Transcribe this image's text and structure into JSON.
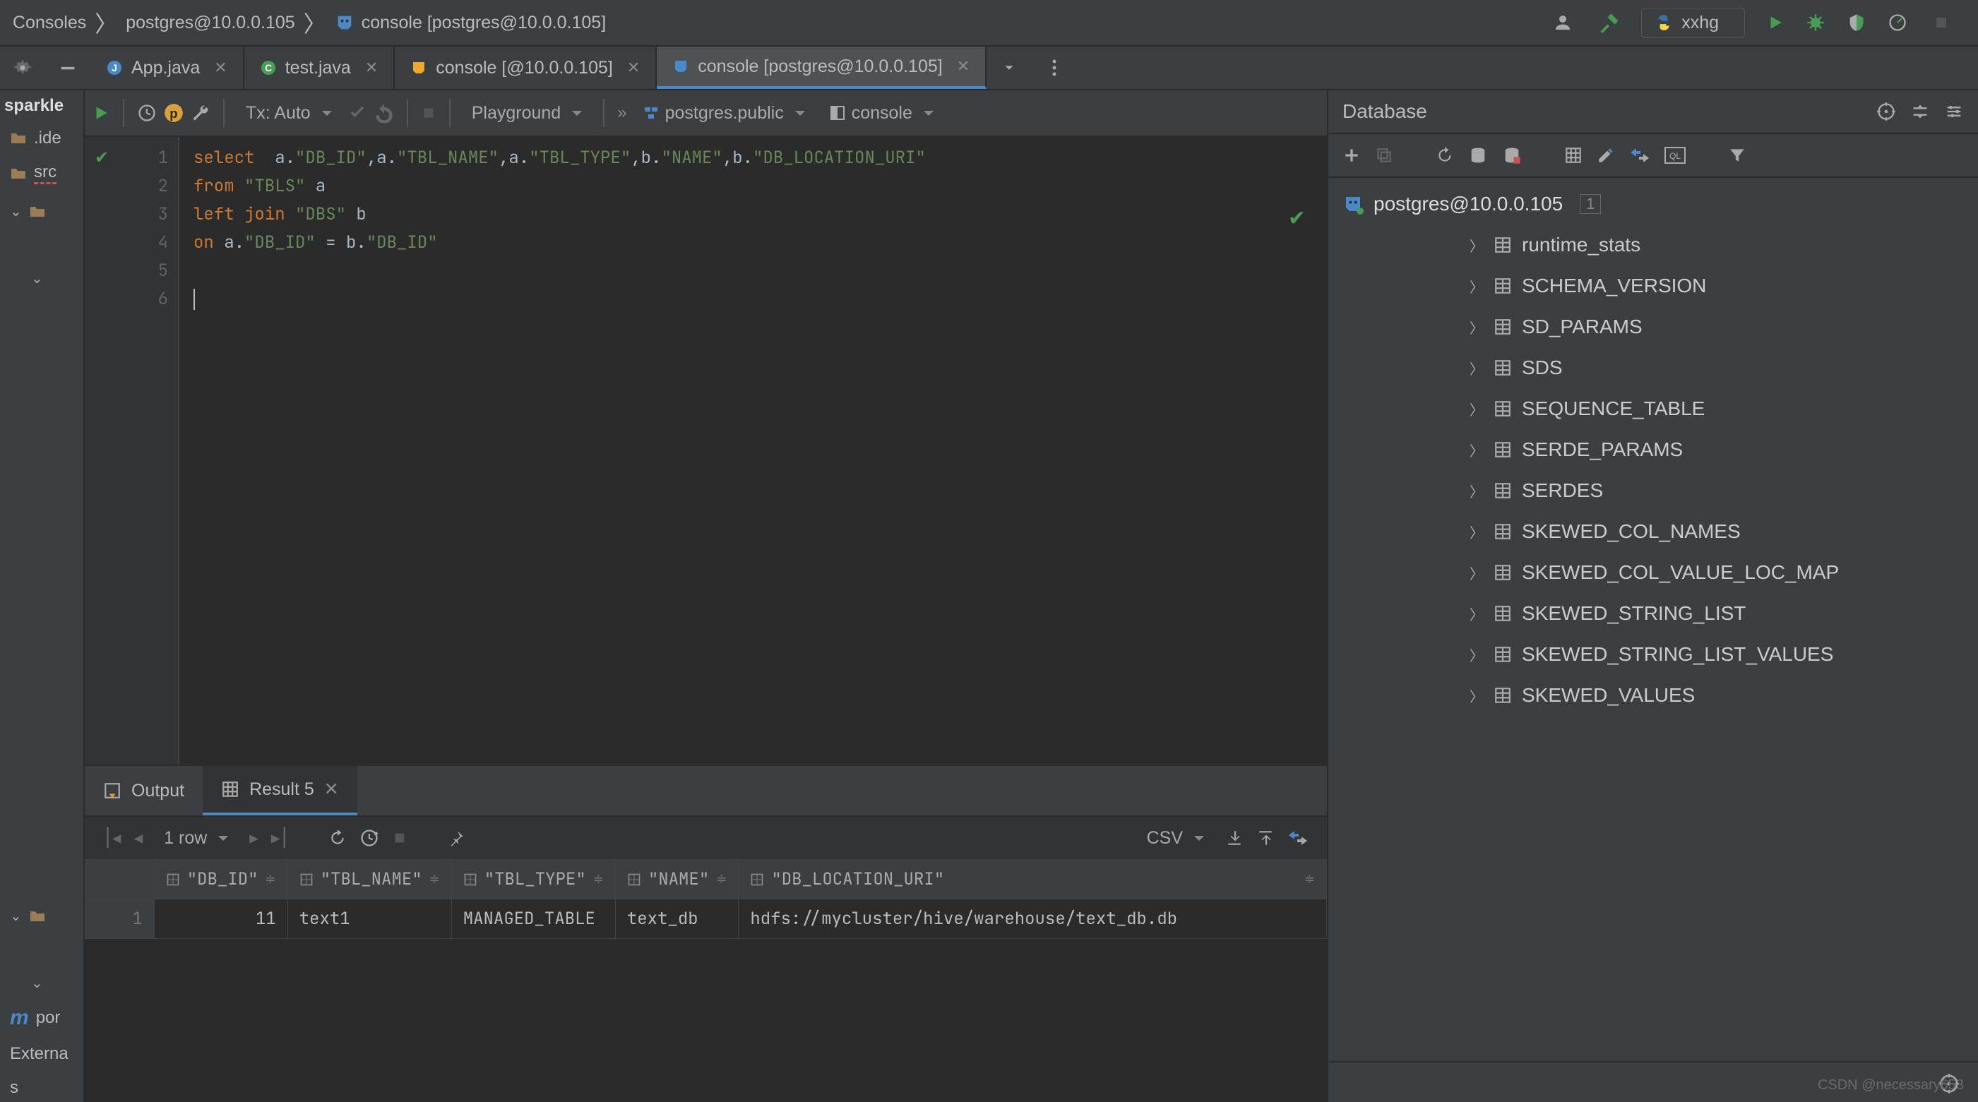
{
  "breadcrumb": {
    "a": "Consoles",
    "b": "postgres@10.0.0.105",
    "c": "console [postgres@10.0.0.105]"
  },
  "interpreter": "xxhg",
  "tabs": [
    {
      "label": "App.java"
    },
    {
      "label": "test.java"
    },
    {
      "label": "console [@10.0.0.105]"
    },
    {
      "label": "console [postgres@10.0.0.105]"
    }
  ],
  "project": {
    "root": "sparkle",
    "idea": ".ide",
    "src": "src",
    "pom": "por",
    "ext": "Externa",
    "svc": "s"
  },
  "sqlbar": {
    "tx": "Tx: Auto",
    "mode": "Playground",
    "schema": "postgres.public",
    "console": "console"
  },
  "sql": {
    "l1a": "select  ",
    "l1b": "a",
    "l1c": ".",
    "l1d": "\"DB_ID\"",
    "l1e": ",a.",
    "l1f": "\"TBL_NAME\"",
    "l1g": ",a.",
    "l1h": "\"TBL_TYPE\"",
    "l1i": ",b.",
    "l1j": "\"NAME\"",
    "l1k": ",b.",
    "l1l": "\"DB_LOCATION_URI\"",
    "l2a": "from ",
    "l2b": "\"TBLS\"",
    "l2c": " a",
    "l3a": "left join ",
    "l3b": "\"DBS\"",
    "l3c": " b",
    "l4a": "on ",
    "l4b": "a.",
    "l4c": "\"DB_ID\"",
    "l4d": " = b.",
    "l4e": "\"DB_ID\""
  },
  "db": {
    "title": "Database",
    "conn": "postgres@10.0.0.105",
    "conn_badge": "1",
    "tables": [
      "runtime_stats",
      "SCHEMA_VERSION",
      "SD_PARAMS",
      "SDS",
      "SEQUENCE_TABLE",
      "SERDE_PARAMS",
      "SERDES",
      "SKEWED_COL_NAMES",
      "SKEWED_COL_VALUE_LOC_MAP",
      "SKEWED_STRING_LIST",
      "SKEWED_STRING_LIST_VALUES",
      "SKEWED_VALUES"
    ]
  },
  "results": {
    "tab_output": "Output",
    "tab_result": "Result 5",
    "rows_label": "1 row",
    "format": "CSV",
    "columns": [
      "\"DB_ID\"",
      "\"TBL_NAME\"",
      "\"TBL_TYPE\"",
      "\"NAME\"",
      "\"DB_LOCATION_URI\""
    ],
    "row": {
      "n": "1",
      "db_id": "11",
      "tbl_name": "text1",
      "tbl_type": "MANAGED_TABLE",
      "name": "text_db",
      "uri": "hdfs://mycluster/hive/warehouse/text_db.db"
    }
  },
  "watermark": "CSDN @necessary653"
}
